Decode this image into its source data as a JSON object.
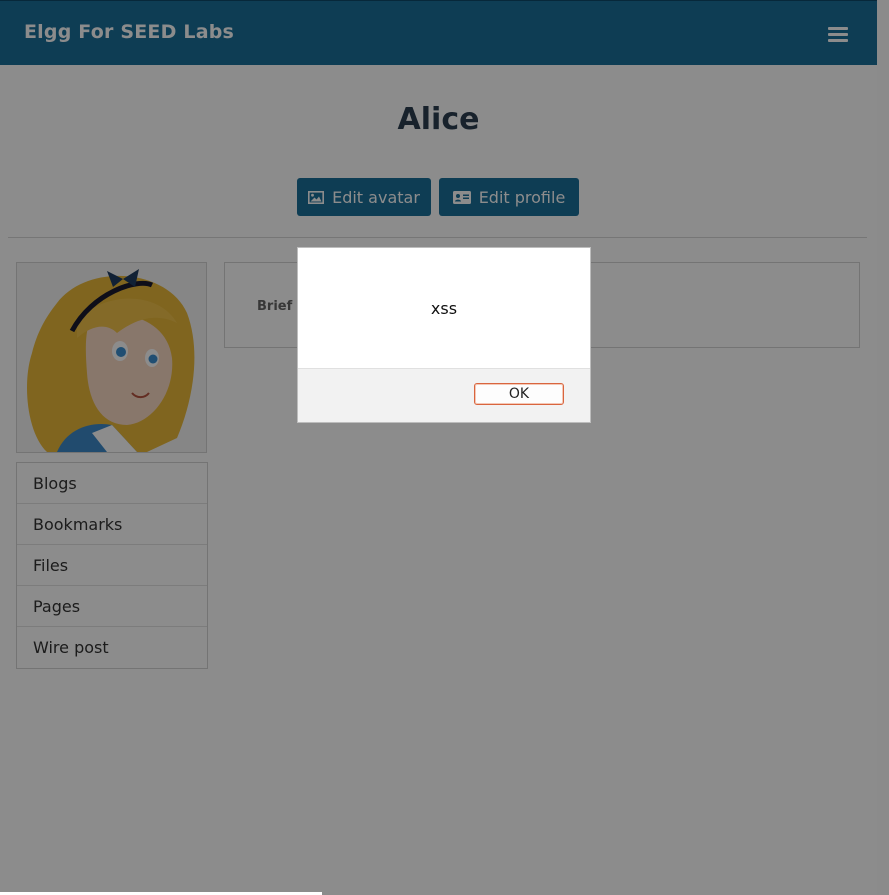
{
  "header": {
    "site_title": "Elgg For SEED Labs",
    "menu_icon": "hamburger-icon"
  },
  "profile": {
    "name": "Alice",
    "edit_avatar_label": "Edit avatar",
    "edit_profile_label": "Edit profile",
    "details_label": "Brief d"
  },
  "sidebar": {
    "items": [
      {
        "label": "Blogs"
      },
      {
        "label": "Bookmarks"
      },
      {
        "label": "Files"
      },
      {
        "label": "Pages"
      },
      {
        "label": "Wire post"
      }
    ]
  },
  "dialog": {
    "message": "xss",
    "ok_label": "OK"
  },
  "colors": {
    "brand": "#1a6f9a",
    "overlay": "rgba(0,0,0,0.45)",
    "ok_border": "#d9653e"
  }
}
